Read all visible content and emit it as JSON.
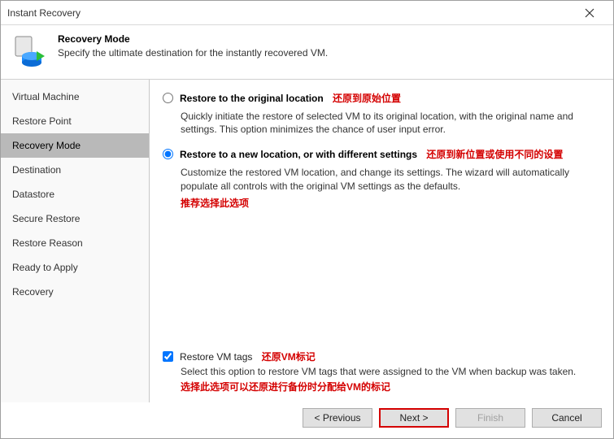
{
  "window": {
    "title": "Instant Recovery"
  },
  "header": {
    "title": "Recovery Mode",
    "subtitle": "Specify the ultimate destination for the instantly recovered VM."
  },
  "sidebar": {
    "items": [
      {
        "label": "Virtual Machine"
      },
      {
        "label": "Restore Point"
      },
      {
        "label": "Recovery Mode"
      },
      {
        "label": "Destination"
      },
      {
        "label": "Datastore"
      },
      {
        "label": "Secure Restore"
      },
      {
        "label": "Restore Reason"
      },
      {
        "label": "Ready to Apply"
      },
      {
        "label": "Recovery"
      }
    ],
    "active_index": 2
  },
  "options": {
    "original": {
      "title": "Restore to the original location",
      "annot": "还原到原始位置",
      "desc": "Quickly initiate the restore of selected VM to its original location, with the original name and settings. This option minimizes the chance of user input error."
    },
    "newloc": {
      "title": "Restore to a new location, or with different settings",
      "annot": "还原到新位置或使用不同的设置",
      "desc": "Customize the restored VM location, and change its settings. The wizard will automatically populate all controls with the original VM settings as the defaults.",
      "recommend": "推荐选择此选项"
    },
    "selected": "newloc"
  },
  "tags": {
    "label": "Restore VM tags",
    "annot": "还原VM标记",
    "desc": "Select this option to restore VM tags that were assigned to the VM when backup was taken.",
    "annot2": "选择此选项可以还原进行备份时分配给VM的标记",
    "checked": true
  },
  "buttons": {
    "previous": "< Previous",
    "next": "Next >",
    "finish": "Finish",
    "cancel": "Cancel"
  }
}
